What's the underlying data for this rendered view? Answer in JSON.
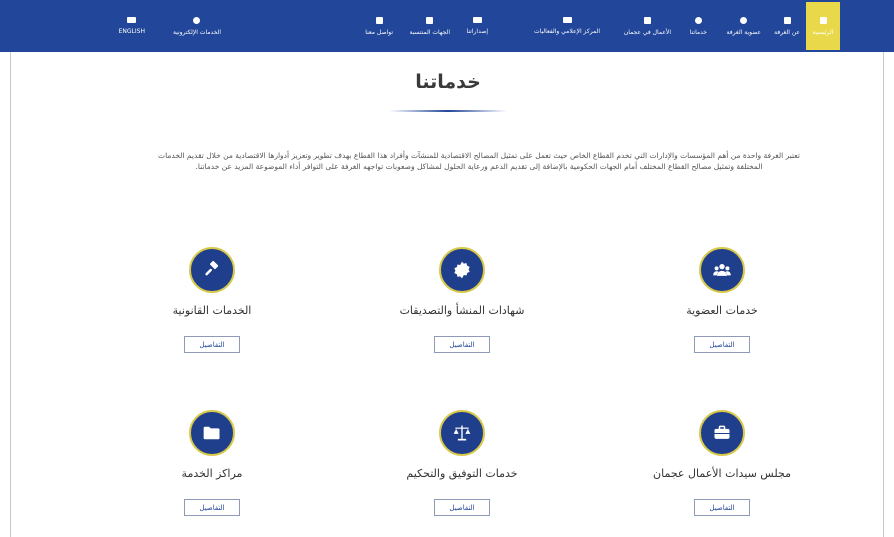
{
  "nav": {
    "items": [
      {
        "key": "home",
        "label": "الرئيسية",
        "icon": "home-icon"
      },
      {
        "key": "about",
        "label": "عن الغرفة",
        "icon": "building-icon"
      },
      {
        "key": "membership",
        "label": "عضوية الغرفة",
        "icon": "members-icon"
      },
      {
        "key": "services",
        "label": "خدماتنا",
        "icon": "services-icon"
      },
      {
        "key": "business",
        "label": "الأعمال في عجمان",
        "icon": "business-icon"
      },
      {
        "key": "media",
        "label": "المركز الإعلامي والفعاليات",
        "icon": "media-icon"
      },
      {
        "key": "publications",
        "label": "إصداراتنا",
        "icon": "book-icon"
      },
      {
        "key": "entities",
        "label": "الجهات المنتسبة",
        "icon": "entities-icon"
      },
      {
        "key": "contact",
        "label": "تواصل معنا",
        "icon": "phone-icon"
      },
      {
        "key": "eservices",
        "label": "الخدمات الإلكترونية",
        "icon": "user-icon"
      },
      {
        "key": "english",
        "label": "ENGLISH",
        "icon": "globe-icon"
      }
    ]
  },
  "page": {
    "title": "خدماتنا",
    "intro": "تعتبر الغرفة واحدة من أهم المؤسسات والإدارات التي تخدم القطاع الخاص حيث تعمل على تمثيل المصالح الاقتصادية للمنشآت وأفراد هذا القطاع بهدف تطوير وتعزيز أدوارها الاقتصادية من خلال تقديم الخدمات المختلفة وتمثيل مصالح القطاع المختلف أمام الجهات الحكومية بالإضافة إلى تقديم الدعم ورعاية الحلول لمشاكل وصعوبات تواجهه الغرفة على التوافر أداء الموضوعة المزيد عن خدماتنا."
  },
  "services": [
    {
      "title": "خدمات العضوية",
      "button": "التفاصيل",
      "icon": "members-icon"
    },
    {
      "title": "شهادات المنشأ والتصديقات",
      "button": "التفاصيل",
      "icon": "seal-icon"
    },
    {
      "title": "الخدمات القانونية",
      "button": "التفاصيل",
      "icon": "gavel-icon"
    },
    {
      "title": "مجلس سيدات الأعمال عجمان",
      "button": "التفاصيل",
      "icon": "briefcase-icon"
    },
    {
      "title": "خدمات التوفيق والتحكيم",
      "button": "التفاصيل",
      "icon": "scales-icon"
    },
    {
      "title": "مراكز الخدمة",
      "button": "التفاصيل",
      "icon": "folder-icon"
    }
  ],
  "colors": {
    "nav_bg": "#22469a",
    "active_tab": "#e9d94a",
    "icon_circle": "#1f3f8c",
    "ring": "#d9c94a"
  }
}
